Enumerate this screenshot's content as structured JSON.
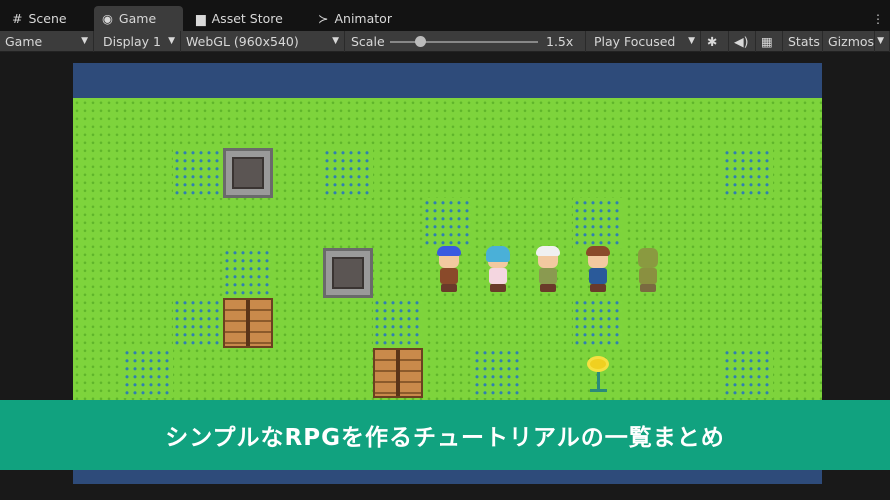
{
  "tabs": [
    {
      "label": "Scene",
      "icon": "grid-icon"
    },
    {
      "label": "Game",
      "icon": "gamepad-icon",
      "active": true
    },
    {
      "label": "Asset Store",
      "icon": "shopping-bag-icon"
    },
    {
      "label": "Animator",
      "icon": "animator-icon"
    }
  ],
  "toolbar": {
    "view_select": "Game",
    "display_select": "Display 1",
    "resolution_select": "WebGL (960x540)",
    "scale_label": "Scale",
    "scale_value": "1.5x",
    "play_mode_select": "Play Focused",
    "stats_label": "Stats",
    "gizmos_label": "Gizmos"
  },
  "banner": {
    "title": "シンプルなRPGを作るチュートリアルの一覧まとめ"
  },
  "colors": {
    "grass": "#7ed43c",
    "sky": "#2e4b7a",
    "banner": "#11a27f"
  }
}
